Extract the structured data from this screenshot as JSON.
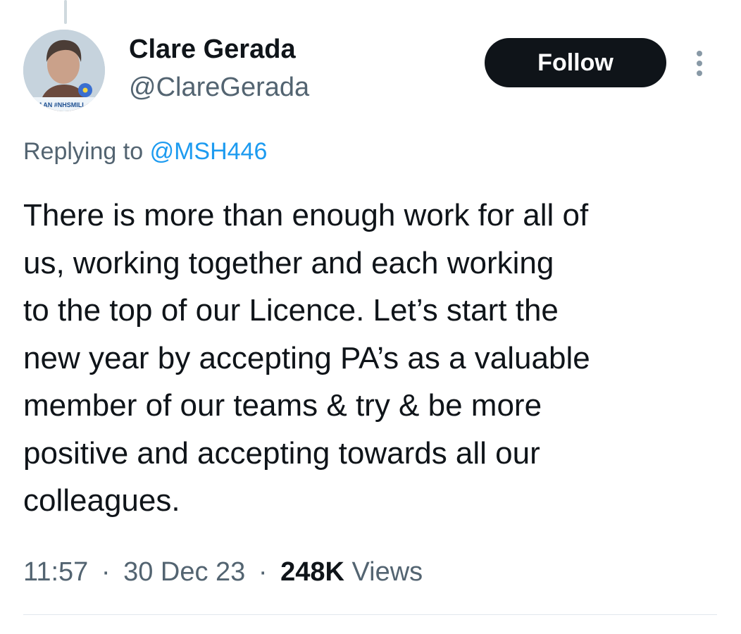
{
  "author": {
    "display_name": "Clare Gerada",
    "handle": "@ClareGerada",
    "avatar_badge_text": "I'M AN #NHSMILL"
  },
  "actions": {
    "follow_label": "Follow",
    "more_icon": "more-vertical-icon"
  },
  "reply": {
    "prefix": "Replying to",
    "target": "@MSH446"
  },
  "tweet": {
    "text": "There is more than enough work for all of\nus, working together and each working\nto the top of our Licence. Let’s start the\nnew year by accepting PA’s as a valuable\nmember of our teams & try & be more\npositive and accepting towards all our\ncolleagues."
  },
  "meta": {
    "time": "11:57",
    "separator": "·",
    "date": "30 Dec 23",
    "views_count": "248K",
    "views_label": "Views"
  },
  "colors": {
    "text_primary": "#0f1419",
    "text_secondary": "#536471",
    "link": "#1d9bf0",
    "button_bg": "#0f1419"
  }
}
